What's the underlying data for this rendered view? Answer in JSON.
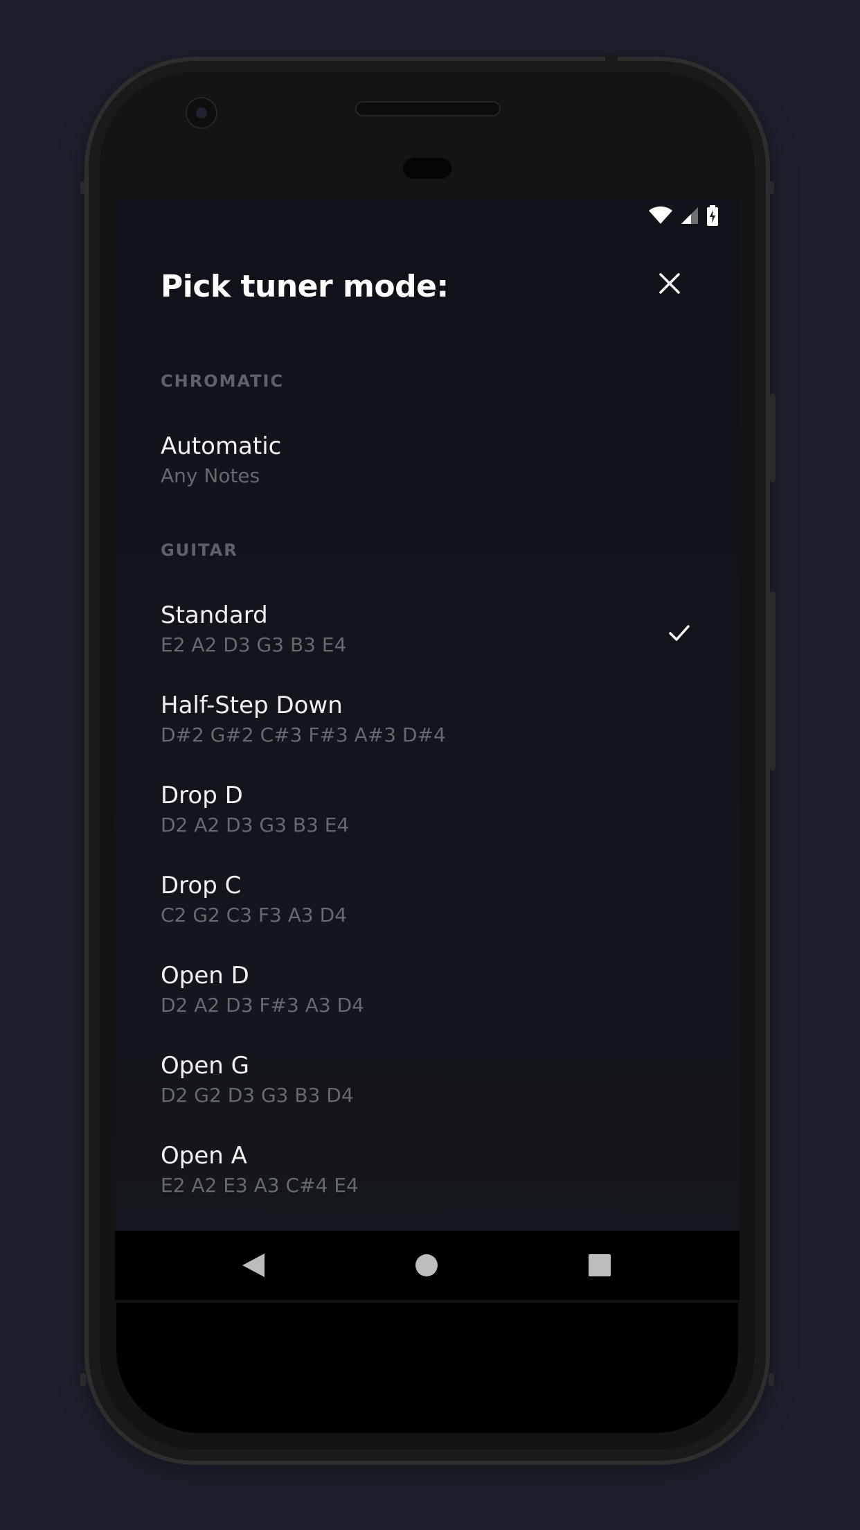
{
  "app": {
    "title": "Pick tuner mode:"
  },
  "status": {
    "icons": [
      "wifi-icon",
      "signal-icon",
      "battery-charging-icon"
    ]
  },
  "sections": [
    {
      "label": "CHROMATIC",
      "options": [
        {
          "name": "Automatic",
          "notes": "Any Notes",
          "selected": false
        }
      ]
    },
    {
      "label": "GUITAR",
      "options": [
        {
          "name": "Standard",
          "notes": "E2 A2 D3 G3 B3 E4",
          "selected": true
        },
        {
          "name": "Half-Step Down",
          "notes": "D#2 G#2 C#3 F#3 A#3 D#4",
          "selected": false
        },
        {
          "name": "Drop D",
          "notes": "D2 A2 D3 G3 B3 E4",
          "selected": false
        },
        {
          "name": "Drop C",
          "notes": "C2 G2 C3 F3 A3 D4",
          "selected": false
        },
        {
          "name": "Open D",
          "notes": "D2 A2 D3 F#3 A3 D4",
          "selected": false
        },
        {
          "name": "Open G",
          "notes": "D2 G2 D3 G3 B3 D4",
          "selected": false
        },
        {
          "name": "Open A",
          "notes": "E2 A2 E3 A3 C#4 E4",
          "selected": false
        }
      ]
    }
  ],
  "nav": {
    "icons": [
      "back-icon",
      "home-icon",
      "recents-icon"
    ]
  },
  "colors": {
    "page_background": "#1b202c",
    "screen_background": "#12151b",
    "primary_text": "#f2f2f2",
    "secondary_text": "#66696f",
    "section_label": "#5e6168"
  }
}
